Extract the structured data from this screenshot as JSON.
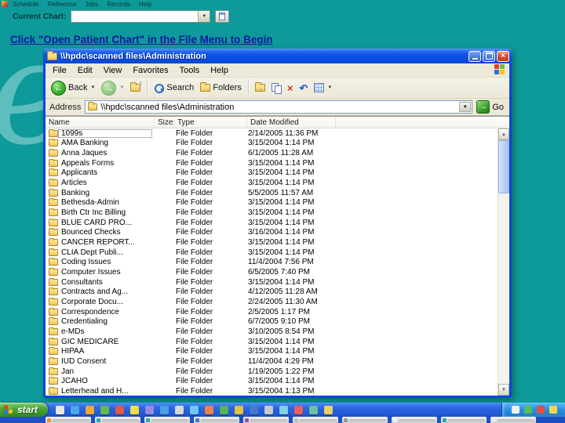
{
  "background_app": {
    "menu_items": [
      "Schedule",
      "Reference",
      "Jobs",
      "Records",
      "Help"
    ],
    "current_chart_label": "Current Chart:",
    "current_chart_value": "",
    "heading": "Click \"Open Patient Chart\" in the File Menu to Begin",
    "watermark_letter": "e"
  },
  "explorer": {
    "title": "\\\\hpdc\\scanned files\\Administration",
    "menu": [
      "File",
      "Edit",
      "View",
      "Favorites",
      "Tools",
      "Help"
    ],
    "toolbar": {
      "back_label": "Back",
      "search_label": "Search",
      "folders_label": "Folders"
    },
    "address": {
      "label": "Address",
      "value": "\\\\hpdc\\scanned files\\Administration",
      "go_label": "Go"
    },
    "columns": [
      "Name",
      "Size",
      "Type",
      "Date Modified"
    ],
    "rows": [
      {
        "name": "1099s",
        "size": "",
        "type": "File Folder",
        "date": "2/14/2005 11:36 PM"
      },
      {
        "name": "AMA Banking",
        "size": "",
        "type": "File Folder",
        "date": "3/15/2004 1:14 PM"
      },
      {
        "name": "Anna Jaques",
        "size": "",
        "type": "File Folder",
        "date": "6/1/2005 11:28 AM"
      },
      {
        "name": "Appeals Forms",
        "size": "",
        "type": "File Folder",
        "date": "3/15/2004 1:14 PM"
      },
      {
        "name": "Applicants",
        "size": "",
        "type": "File Folder",
        "date": "3/15/2004 1:14 PM"
      },
      {
        "name": "Articles",
        "size": "",
        "type": "File Folder",
        "date": "3/15/2004 1:14 PM"
      },
      {
        "name": "Banking",
        "size": "",
        "type": "File Folder",
        "date": "5/5/2005 11:57 AM"
      },
      {
        "name": "Bethesda-Admin",
        "size": "",
        "type": "File Folder",
        "date": "3/15/2004 1:14 PM"
      },
      {
        "name": "Birth Ctr Inc Billing",
        "size": "",
        "type": "File Folder",
        "date": "3/15/2004 1:14 PM"
      },
      {
        "name": "BLUE CARD PRO...",
        "size": "",
        "type": "File Folder",
        "date": "3/15/2004 1:14 PM"
      },
      {
        "name": "Bounced Checks",
        "size": "",
        "type": "File Folder",
        "date": "3/16/2004 1:14 PM"
      },
      {
        "name": "CANCER REPORT...",
        "size": "",
        "type": "File Folder",
        "date": "3/15/2004 1:14 PM"
      },
      {
        "name": "CLIA Dept Publi...",
        "size": "",
        "type": "File Folder",
        "date": "3/15/2004 1:14 PM"
      },
      {
        "name": "Coding Issues",
        "size": "",
        "type": "File Folder",
        "date": "11/4/2004 7:56 PM"
      },
      {
        "name": "Computer Issues",
        "size": "",
        "type": "File Folder",
        "date": "6/5/2005 7:40 PM"
      },
      {
        "name": "Consultants",
        "size": "",
        "type": "File Folder",
        "date": "3/15/2004 1:14 PM"
      },
      {
        "name": "Contracts and Ag...",
        "size": "",
        "type": "File Folder",
        "date": "4/12/2005 11:28 AM"
      },
      {
        "name": "Corporate Docu...",
        "size": "",
        "type": "File Folder",
        "date": "2/24/2005 11:30 AM"
      },
      {
        "name": "Correspondence",
        "size": "",
        "type": "File Folder",
        "date": "2/5/2005 1:17 PM"
      },
      {
        "name": "Credentialing",
        "size": "",
        "type": "File Folder",
        "date": "6/7/2005 9:10 PM"
      },
      {
        "name": "e-MDs",
        "size": "",
        "type": "File Folder",
        "date": "3/10/2005 8:54 PM"
      },
      {
        "name": "GIC MEDICARE",
        "size": "",
        "type": "File Folder",
        "date": "3/15/2004 1:14 PM"
      },
      {
        "name": "HIPAA",
        "size": "",
        "type": "File Folder",
        "date": "3/15/2004 1:14 PM"
      },
      {
        "name": "IUD Consent",
        "size": "",
        "type": "File Folder",
        "date": "11/4/2004 4:29 PM"
      },
      {
        "name": "Jan",
        "size": "",
        "type": "File Folder",
        "date": "1/19/2005 1:22 PM"
      },
      {
        "name": "JCAHO",
        "size": "",
        "type": "File Folder",
        "date": "3/15/2004 1:14 PM"
      },
      {
        "name": "Letterhead and H...",
        "size": "",
        "type": "File Folder",
        "date": "3/15/2004 1:13 PM"
      }
    ]
  },
  "taskbar": {
    "start_label": "start",
    "quick_icon_colors": [
      "#e8e6e0",
      "#4aa8e8",
      "#f0a838",
      "#68b848",
      "#e05848",
      "#f0e048",
      "#9a88e0",
      "#48a0e0",
      "#d8d8d8",
      "#70c8f0",
      "#f08048",
      "#58b058",
      "#e8c040",
      "#4878d0",
      "#c8c8c8",
      "#80d0e8",
      "#e86060",
      "#68c0a0",
      "#f0d060"
    ],
    "tray_icon_colors": [
      "#f0f0f0",
      "#58c058",
      "#e05040",
      "#f8d848"
    ],
    "window_button_colors": [
      "#e8923a",
      "#2fa8a8",
      "#2fa8a8",
      "#4a78d8",
      "#9058c0",
      "#c0c0c0",
      "#9a9a9a",
      "#f0f0f0",
      "#2fa8a8",
      "#e8e8e8"
    ]
  },
  "colors": {
    "desktop_teal": "#0E9A9A",
    "heading_blue": "#0D17A5",
    "titlebar_blue": "#0A50E6",
    "taskbar_blue": "#2666E0",
    "start_green": "#3F9C2E"
  }
}
